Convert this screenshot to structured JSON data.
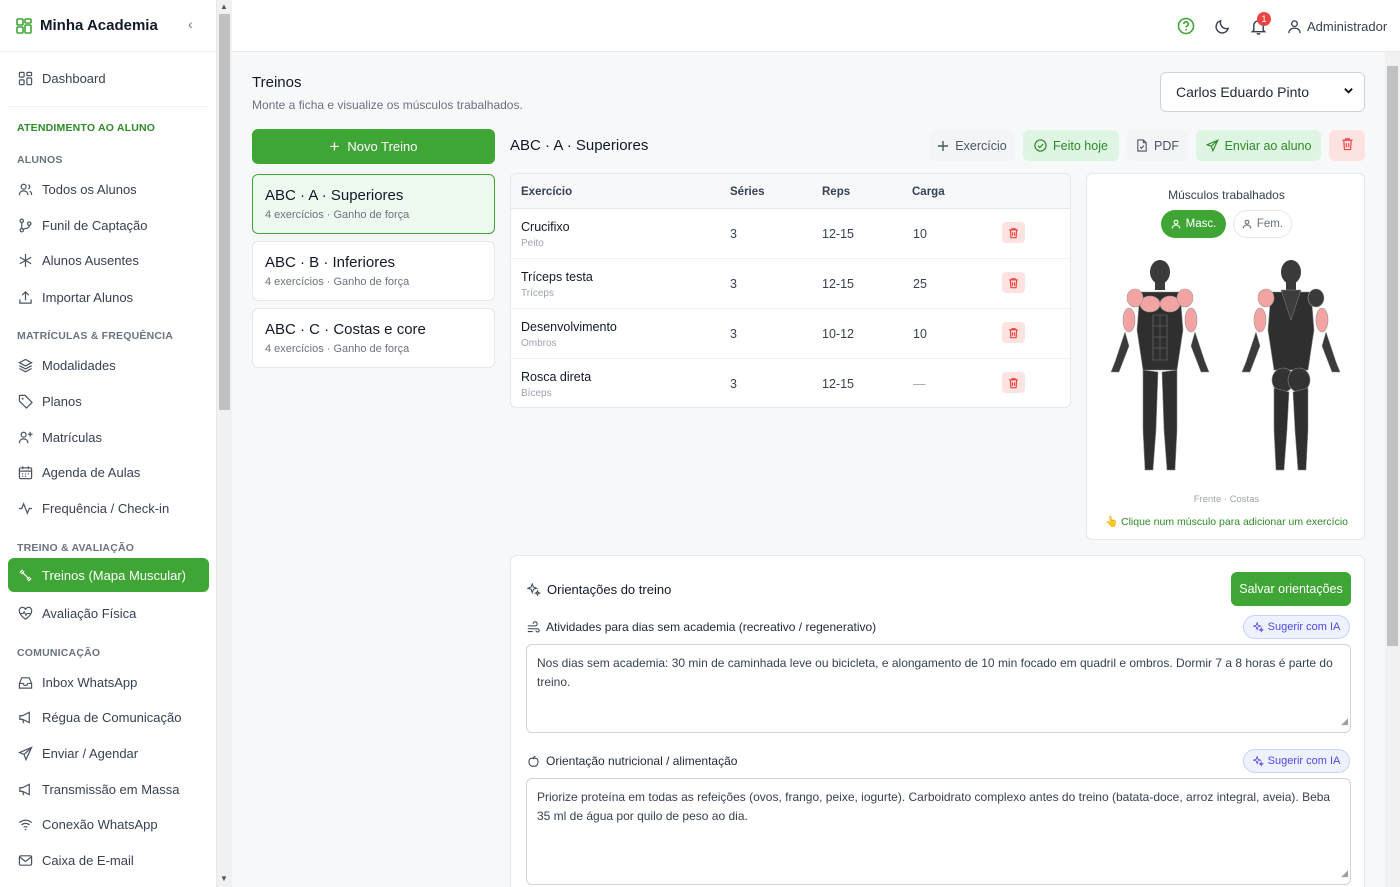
{
  "app": {
    "name": "Minha Academia"
  },
  "sidebar": {
    "dashboard": "Dashboard",
    "sections": {
      "atendimento": "ATENDIMENTO AO ALUNO",
      "alunos": "ALUNOS",
      "matriculas": "MATRÍCULAS & FREQUÊNCIA",
      "treino": "TREINO & AVALIAÇÃO",
      "comunicacao": "COMUNICAÇÃO"
    },
    "items": [
      {
        "label": "Todos os Alunos",
        "icon": "users-icon"
      },
      {
        "label": "Funil de Captação",
        "icon": "funnel-icon"
      },
      {
        "label": "Alunos Ausentes",
        "icon": "snowflake-icon"
      },
      {
        "label": "Importar Alunos",
        "icon": "upload-icon"
      },
      {
        "label": "Modalidades",
        "icon": "layers-icon"
      },
      {
        "label": "Planos",
        "icon": "tag-icon"
      },
      {
        "label": "Matrículas",
        "icon": "user-plus-icon"
      },
      {
        "label": "Agenda de Aulas",
        "icon": "calendar-icon"
      },
      {
        "label": "Frequência / Check-in",
        "icon": "activity-icon"
      },
      {
        "label": "Treinos (Mapa Muscular)",
        "icon": "dumbbell-icon"
      },
      {
        "label": "Avaliação Física",
        "icon": "heart-pulse-icon"
      },
      {
        "label": "Inbox WhatsApp",
        "icon": "inbox-icon"
      },
      {
        "label": "Régua de Comunicação",
        "icon": "megaphone-icon"
      },
      {
        "label": "Enviar / Agendar",
        "icon": "send-icon"
      },
      {
        "label": "Transmissão em Massa",
        "icon": "megaphone-icon"
      },
      {
        "label": "Conexão WhatsApp",
        "icon": "wifi-icon"
      },
      {
        "label": "Caixa de E-mail",
        "icon": "mail-icon"
      }
    ]
  },
  "topbar": {
    "notifications": "1",
    "user": "Administrador"
  },
  "page": {
    "title": "Treinos",
    "subtitle": "Monte a ficha e visualize os músculos trabalhados.",
    "student": "Carlos Eduardo Pinto",
    "new_workout": "Novo Treino"
  },
  "workouts": [
    {
      "title": "ABC · A · Superiores",
      "sub": "4 exercícios · Ganho de força"
    },
    {
      "title": "ABC · B · Inferiores",
      "sub": "4 exercícios · Ganho de força"
    },
    {
      "title": "ABC · C · Costas e core",
      "sub": "4 exercícios · Ganho de força"
    }
  ],
  "current": {
    "title": "ABC · A · Superiores",
    "buttons": {
      "exercise": "Exercício",
      "done": "Feito hoje",
      "pdf": "PDF",
      "send": "Enviar ao aluno"
    },
    "columns": {
      "exercise": "Exercício",
      "sets": "Séries",
      "reps": "Reps",
      "load": "Carga"
    },
    "rows": [
      {
        "name": "Crucifixo",
        "muscle": "Peito",
        "sets": "3",
        "reps": "12-15",
        "load": "10"
      },
      {
        "name": "Tríceps testa",
        "muscle": "Tríceps",
        "sets": "3",
        "reps": "12-15",
        "load": "25"
      },
      {
        "name": "Desenvolvimento",
        "muscle": "Ombros",
        "sets": "3",
        "reps": "10-12",
        "load": "10"
      },
      {
        "name": "Rosca direta",
        "muscle": "Bíceps",
        "sets": "3",
        "reps": "12-15",
        "load": "—"
      }
    ]
  },
  "muscles": {
    "title": "Músculos trabalhados",
    "male": "Masc.",
    "female": "Fem.",
    "caption": "Frente · Costas",
    "hint": "Clique num músculo para adicionar um exercício"
  },
  "guidance": {
    "title": "Orientações do treino",
    "save": "Salvar orientações",
    "ai": "Sugerir com IA",
    "rest_label": "Atividades para dias sem academia (recreativo / regenerativo)",
    "rest_text": "Nos dias sem academia: 30 min de caminhada leve ou bicicleta, e alongamento de 10 min focado em quadril e ombros. Dormir 7 a 8 horas é parte do treino.",
    "nutrition_label": "Orientação nutricional / alimentação",
    "nutrition_text": "Priorize proteína em todas as refeições (ovos, frango, peixe, iogurte). Carboidrato complexo antes do treino (batata-doce, arroz integral, aveia). Beba 35 ml de água por quilo de peso ao dia."
  },
  "colors": {
    "accent": "#3fa535",
    "danger": "#ef4444",
    "muscle_highlight": "#f4a3a3"
  }
}
